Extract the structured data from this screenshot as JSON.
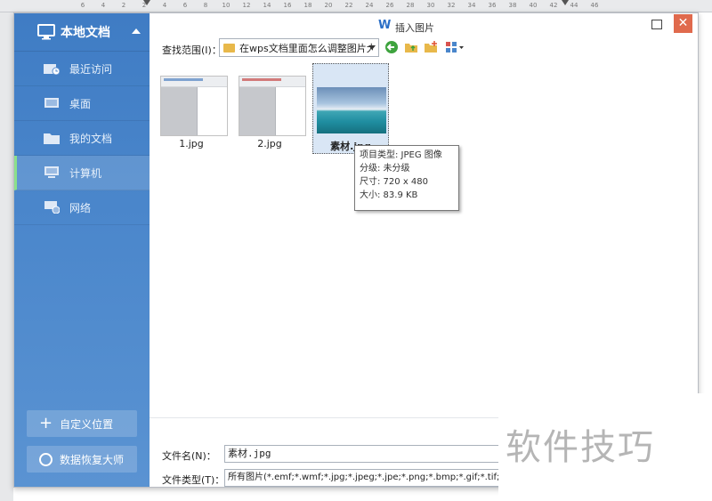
{
  "ruler": {
    "ticks": [
      "6",
      "4",
      "2",
      "2",
      "4",
      "6",
      "8",
      "10",
      "12",
      "14",
      "16",
      "18",
      "20",
      "22",
      "24",
      "26",
      "28",
      "30",
      "32",
      "34",
      "36",
      "38",
      "40",
      "42",
      "44",
      "46"
    ]
  },
  "sidebar": {
    "title": "本地文档",
    "items": [
      {
        "label": "最近访问",
        "icon": "recent-icon"
      },
      {
        "label": "桌面",
        "icon": "desktop-icon"
      },
      {
        "label": "我的文档",
        "icon": "folder-icon"
      },
      {
        "label": "计算机",
        "icon": "computer-icon",
        "active": true
      },
      {
        "label": "网络",
        "icon": "network-icon"
      }
    ],
    "custom_location_label": "自定义位置",
    "data_recovery_label": "数据恢复大师"
  },
  "titlebar": {
    "logo": "W",
    "title": "插入图片"
  },
  "lookin": {
    "label": "查找范围(I)：",
    "value": "在wps文档里面怎么调整图片大小"
  },
  "files": [
    {
      "name": "1.jpg",
      "kind": "document"
    },
    {
      "name": "2.jpg",
      "kind": "document"
    },
    {
      "name": "素材.jpg",
      "kind": "photo",
      "selected": true
    }
  ],
  "tooltip": {
    "type_line": "项目类型: JPEG 图像",
    "rating_line": "分级: 未分级",
    "size_line": "尺寸: 720 x 480",
    "filesize_line": "大小: 83.9 KB"
  },
  "bottom": {
    "filename_label": "文件名(N)：",
    "filename_value": "素材.jpg",
    "filetype_label": "文件类型(T)：",
    "filetype_value": "所有图片(*.emf;*.wmf;*.jpg;*.jpeg;*.jpe;*.png;*.bmp;*.gif;*.tif;*.tiff;*.w"
  },
  "watermark": {
    "text": "软件技巧"
  },
  "colors": {
    "sidebar_blue": "#4a86cb",
    "active_accent": "#8be08b",
    "close_button": "#e06a4d"
  }
}
